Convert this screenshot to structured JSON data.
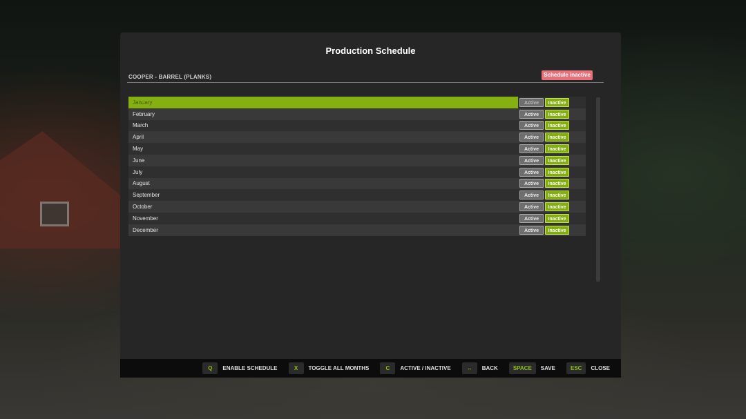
{
  "panel": {
    "title": "Production Schedule",
    "production_name": "COOPER - BARREL (PLANKS)",
    "status_badge": "Schedule inactive"
  },
  "months": [
    {
      "label": "January",
      "active_label": "Active",
      "inactive_label": "Inactive",
      "selected": true
    },
    {
      "label": "February",
      "active_label": "Active",
      "inactive_label": "Inactive"
    },
    {
      "label": "March",
      "active_label": "Active",
      "inactive_label": "Inactive"
    },
    {
      "label": "April",
      "active_label": "Active",
      "inactive_label": "Inactive"
    },
    {
      "label": "May",
      "active_label": "Active",
      "inactive_label": "Inactive"
    },
    {
      "label": "June",
      "active_label": "Active",
      "inactive_label": "Inactive"
    },
    {
      "label": "July",
      "active_label": "Active",
      "inactive_label": "Inactive"
    },
    {
      "label": "August",
      "active_label": "Active",
      "inactive_label": "Inactive"
    },
    {
      "label": "September",
      "active_label": "Active",
      "inactive_label": "Inactive"
    },
    {
      "label": "October",
      "active_label": "Active",
      "inactive_label": "Inactive"
    },
    {
      "label": "November",
      "active_label": "Active",
      "inactive_label": "Inactive"
    },
    {
      "label": "December",
      "active_label": "Active",
      "inactive_label": "Inactive"
    }
  ],
  "footer": {
    "hints": [
      {
        "key": "Q",
        "label": "ENABLE SCHEDULE"
      },
      {
        "key": "X",
        "label": "TOGGLE ALL MONTHS"
      },
      {
        "key": "C",
        "label": "ACTIVE / INACTIVE"
      },
      {
        "key": "↔",
        "label": "BACK"
      },
      {
        "key": "SPACE",
        "label": "SAVE"
      },
      {
        "key": "ESC",
        "label": "CLOSE"
      }
    ]
  },
  "colors": {
    "accent_green": "#86b012",
    "badge_red": "#e8707b",
    "key_green": "#8fbf17"
  }
}
